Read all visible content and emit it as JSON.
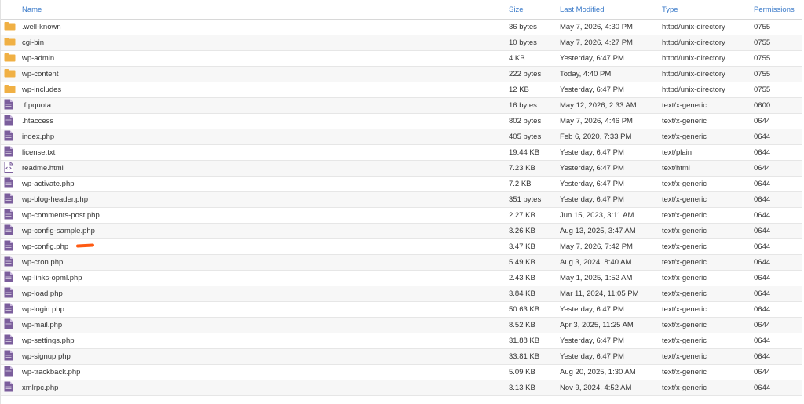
{
  "columns": {
    "name": "Name",
    "size": "Size",
    "last_modified": "Last Modified",
    "type": "Type",
    "permissions": "Permissions"
  },
  "colors": {
    "header_link": "#3a7ac9",
    "folder": "#f0b044",
    "file": "#7b5e9c",
    "annotation_mark": "#ff5a12"
  },
  "files": [
    {
      "icon": "folder-icon",
      "name": ".well-known",
      "size": "36 bytes",
      "modified": "May 7, 2026, 4:30 PM",
      "type": "httpd/unix-directory",
      "perms": "0755"
    },
    {
      "icon": "folder-icon",
      "name": "cgi-bin",
      "size": "10 bytes",
      "modified": "May 7, 2026, 4:27 PM",
      "type": "httpd/unix-directory",
      "perms": "0755"
    },
    {
      "icon": "folder-icon",
      "name": "wp-admin",
      "size": "4 KB",
      "modified": "Yesterday, 6:47 PM",
      "type": "httpd/unix-directory",
      "perms": "0755"
    },
    {
      "icon": "folder-icon",
      "name": "wp-content",
      "size": "222 bytes",
      "modified": "Today, 4:40 PM",
      "type": "httpd/unix-directory",
      "perms": "0755"
    },
    {
      "icon": "folder-icon",
      "name": "wp-includes",
      "size": "12 KB",
      "modified": "Yesterday, 6:47 PM",
      "type": "httpd/unix-directory",
      "perms": "0755"
    },
    {
      "icon": "file-icon",
      "name": ".ftpquota",
      "size": "16 bytes",
      "modified": "May 12, 2026, 2:33 AM",
      "type": "text/x-generic",
      "perms": "0600"
    },
    {
      "icon": "file-icon",
      "name": ".htaccess",
      "size": "802 bytes",
      "modified": "May 7, 2026, 4:46 PM",
      "type": "text/x-generic",
      "perms": "0644"
    },
    {
      "icon": "file-icon",
      "name": "index.php",
      "size": "405 bytes",
      "modified": "Feb 6, 2020, 7:33 PM",
      "type": "text/x-generic",
      "perms": "0644"
    },
    {
      "icon": "file-icon",
      "name": "license.txt",
      "size": "19.44 KB",
      "modified": "Yesterday, 6:47 PM",
      "type": "text/plain",
      "perms": "0644"
    },
    {
      "icon": "html-file-icon",
      "name": "readme.html",
      "size": "7.23 KB",
      "modified": "Yesterday, 6:47 PM",
      "type": "text/html",
      "perms": "0644"
    },
    {
      "icon": "file-icon",
      "name": "wp-activate.php",
      "size": "7.2 KB",
      "modified": "Yesterday, 6:47 PM",
      "type": "text/x-generic",
      "perms": "0644"
    },
    {
      "icon": "file-icon",
      "name": "wp-blog-header.php",
      "size": "351 bytes",
      "modified": "Yesterday, 6:47 PM",
      "type": "text/x-generic",
      "perms": "0644"
    },
    {
      "icon": "file-icon",
      "name": "wp-comments-post.php",
      "size": "2.27 KB",
      "modified": "Jun 15, 2023, 3:11 AM",
      "type": "text/x-generic",
      "perms": "0644"
    },
    {
      "icon": "file-icon",
      "name": "wp-config-sample.php",
      "size": "3.26 KB",
      "modified": "Aug 13, 2025, 3:47 AM",
      "type": "text/x-generic",
      "perms": "0644"
    },
    {
      "icon": "file-icon",
      "name": "wp-config.php",
      "size": "3.47 KB",
      "modified": "May 7, 2026, 7:42 PM",
      "type": "text/x-generic",
      "perms": "0644"
    },
    {
      "icon": "file-icon",
      "name": "wp-cron.php",
      "size": "5.49 KB",
      "modified": "Aug 3, 2024, 8:40 AM",
      "type": "text/x-generic",
      "perms": "0644"
    },
    {
      "icon": "file-icon",
      "name": "wp-links-opml.php",
      "size": "2.43 KB",
      "modified": "May 1, 2025, 1:52 AM",
      "type": "text/x-generic",
      "perms": "0644"
    },
    {
      "icon": "file-icon",
      "name": "wp-load.php",
      "size": "3.84 KB",
      "modified": "Mar 11, 2024, 11:05 PM",
      "type": "text/x-generic",
      "perms": "0644"
    },
    {
      "icon": "file-icon",
      "name": "wp-login.php",
      "size": "50.63 KB",
      "modified": "Yesterday, 6:47 PM",
      "type": "text/x-generic",
      "perms": "0644"
    },
    {
      "icon": "file-icon",
      "name": "wp-mail.php",
      "size": "8.52 KB",
      "modified": "Apr 3, 2025, 11:25 AM",
      "type": "text/x-generic",
      "perms": "0644"
    },
    {
      "icon": "file-icon",
      "name": "wp-settings.php",
      "size": "31.88 KB",
      "modified": "Yesterday, 6:47 PM",
      "type": "text/x-generic",
      "perms": "0644"
    },
    {
      "icon": "file-icon",
      "name": "wp-signup.php",
      "size": "33.81 KB",
      "modified": "Yesterday, 6:47 PM",
      "type": "text/x-generic",
      "perms": "0644"
    },
    {
      "icon": "file-icon",
      "name": "wp-trackback.php",
      "size": "5.09 KB",
      "modified": "Aug 20, 2025, 1:30 AM",
      "type": "text/x-generic",
      "perms": "0644"
    },
    {
      "icon": "file-icon",
      "name": "xmlrpc.php",
      "size": "3.13 KB",
      "modified": "Nov 9, 2024, 4:52 AM",
      "type": "text/x-generic",
      "perms": "0644"
    }
  ]
}
